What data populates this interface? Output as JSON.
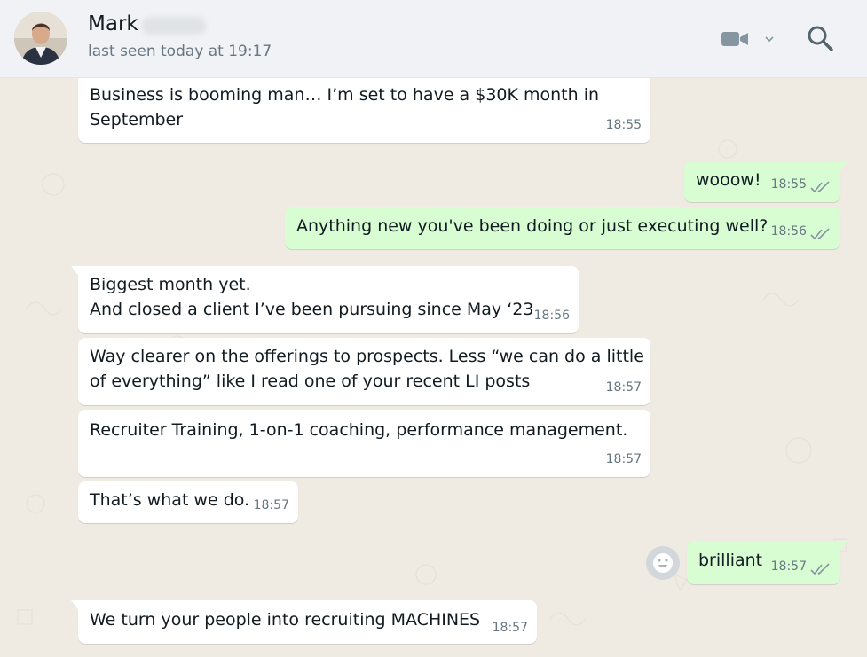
{
  "header": {
    "contact_name": "Mark",
    "status": "last seen today at 19:17",
    "icons": {
      "video": "video-camera-icon",
      "dropdown": "chevron-down-icon",
      "search": "search-icon"
    }
  },
  "messages": [
    {
      "direction": "in",
      "lines": [
        "Business is booming man… I’m set to have a $30K month in",
        "September"
      ],
      "time": "18:55"
    },
    {
      "direction": "out",
      "lines": [
        "wooow!"
      ],
      "time": "18:55",
      "read": true
    },
    {
      "direction": "out",
      "lines": [
        "Anything new you've been doing or just executing well?"
      ],
      "time": "18:56",
      "read": true
    },
    {
      "direction": "in",
      "lines": [
        "Biggest month yet.",
        "And closed a client I’ve been pursuing since May ‘23"
      ],
      "time": "18:56"
    },
    {
      "direction": "in",
      "lines": [
        "Way clearer on the offerings to prospects. Less “we can do a little",
        "of everything” like I read one of your recent LI posts"
      ],
      "time": "18:57"
    },
    {
      "direction": "in",
      "lines": [
        "Recruiter Training, 1-on-1 coaching, performance management."
      ],
      "time": "18:57"
    },
    {
      "direction": "in",
      "lines": [
        "That’s what we do."
      ],
      "time": "18:57"
    },
    {
      "direction": "out",
      "lines": [
        "brilliant"
      ],
      "time": "18:57",
      "read": true
    },
    {
      "direction": "in",
      "lines": [
        "We turn your people into recruiting MACHINES"
      ],
      "time": "18:57"
    }
  ],
  "colors": {
    "chat_background": "#efeae2",
    "header_background": "#f0f2f5",
    "incoming_bubble": "#ffffff",
    "outgoing_bubble": "#d9fdd3",
    "read_tick": "#8696a0",
    "meta_text": "#667781"
  }
}
